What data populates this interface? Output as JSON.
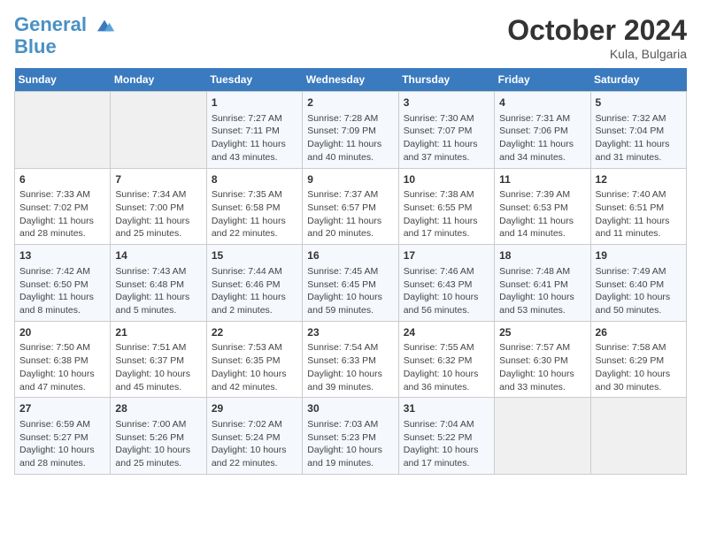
{
  "header": {
    "logo_line1": "General",
    "logo_line2": "Blue",
    "month": "October 2024",
    "location": "Kula, Bulgaria"
  },
  "days_of_week": [
    "Sunday",
    "Monday",
    "Tuesday",
    "Wednesday",
    "Thursday",
    "Friday",
    "Saturday"
  ],
  "weeks": [
    [
      {
        "day": "",
        "info": ""
      },
      {
        "day": "",
        "info": ""
      },
      {
        "day": "1",
        "info": "Sunrise: 7:27 AM\nSunset: 7:11 PM\nDaylight: 11 hours and 43 minutes."
      },
      {
        "day": "2",
        "info": "Sunrise: 7:28 AM\nSunset: 7:09 PM\nDaylight: 11 hours and 40 minutes."
      },
      {
        "day": "3",
        "info": "Sunrise: 7:30 AM\nSunset: 7:07 PM\nDaylight: 11 hours and 37 minutes."
      },
      {
        "day": "4",
        "info": "Sunrise: 7:31 AM\nSunset: 7:06 PM\nDaylight: 11 hours and 34 minutes."
      },
      {
        "day": "5",
        "info": "Sunrise: 7:32 AM\nSunset: 7:04 PM\nDaylight: 11 hours and 31 minutes."
      }
    ],
    [
      {
        "day": "6",
        "info": "Sunrise: 7:33 AM\nSunset: 7:02 PM\nDaylight: 11 hours and 28 minutes."
      },
      {
        "day": "7",
        "info": "Sunrise: 7:34 AM\nSunset: 7:00 PM\nDaylight: 11 hours and 25 minutes."
      },
      {
        "day": "8",
        "info": "Sunrise: 7:35 AM\nSunset: 6:58 PM\nDaylight: 11 hours and 22 minutes."
      },
      {
        "day": "9",
        "info": "Sunrise: 7:37 AM\nSunset: 6:57 PM\nDaylight: 11 hours and 20 minutes."
      },
      {
        "day": "10",
        "info": "Sunrise: 7:38 AM\nSunset: 6:55 PM\nDaylight: 11 hours and 17 minutes."
      },
      {
        "day": "11",
        "info": "Sunrise: 7:39 AM\nSunset: 6:53 PM\nDaylight: 11 hours and 14 minutes."
      },
      {
        "day": "12",
        "info": "Sunrise: 7:40 AM\nSunset: 6:51 PM\nDaylight: 11 hours and 11 minutes."
      }
    ],
    [
      {
        "day": "13",
        "info": "Sunrise: 7:42 AM\nSunset: 6:50 PM\nDaylight: 11 hours and 8 minutes."
      },
      {
        "day": "14",
        "info": "Sunrise: 7:43 AM\nSunset: 6:48 PM\nDaylight: 11 hours and 5 minutes."
      },
      {
        "day": "15",
        "info": "Sunrise: 7:44 AM\nSunset: 6:46 PM\nDaylight: 11 hours and 2 minutes."
      },
      {
        "day": "16",
        "info": "Sunrise: 7:45 AM\nSunset: 6:45 PM\nDaylight: 10 hours and 59 minutes."
      },
      {
        "day": "17",
        "info": "Sunrise: 7:46 AM\nSunset: 6:43 PM\nDaylight: 10 hours and 56 minutes."
      },
      {
        "day": "18",
        "info": "Sunrise: 7:48 AM\nSunset: 6:41 PM\nDaylight: 10 hours and 53 minutes."
      },
      {
        "day": "19",
        "info": "Sunrise: 7:49 AM\nSunset: 6:40 PM\nDaylight: 10 hours and 50 minutes."
      }
    ],
    [
      {
        "day": "20",
        "info": "Sunrise: 7:50 AM\nSunset: 6:38 PM\nDaylight: 10 hours and 47 minutes."
      },
      {
        "day": "21",
        "info": "Sunrise: 7:51 AM\nSunset: 6:37 PM\nDaylight: 10 hours and 45 minutes."
      },
      {
        "day": "22",
        "info": "Sunrise: 7:53 AM\nSunset: 6:35 PM\nDaylight: 10 hours and 42 minutes."
      },
      {
        "day": "23",
        "info": "Sunrise: 7:54 AM\nSunset: 6:33 PM\nDaylight: 10 hours and 39 minutes."
      },
      {
        "day": "24",
        "info": "Sunrise: 7:55 AM\nSunset: 6:32 PM\nDaylight: 10 hours and 36 minutes."
      },
      {
        "day": "25",
        "info": "Sunrise: 7:57 AM\nSunset: 6:30 PM\nDaylight: 10 hours and 33 minutes."
      },
      {
        "day": "26",
        "info": "Sunrise: 7:58 AM\nSunset: 6:29 PM\nDaylight: 10 hours and 30 minutes."
      }
    ],
    [
      {
        "day": "27",
        "info": "Sunrise: 6:59 AM\nSunset: 5:27 PM\nDaylight: 10 hours and 28 minutes."
      },
      {
        "day": "28",
        "info": "Sunrise: 7:00 AM\nSunset: 5:26 PM\nDaylight: 10 hours and 25 minutes."
      },
      {
        "day": "29",
        "info": "Sunrise: 7:02 AM\nSunset: 5:24 PM\nDaylight: 10 hours and 22 minutes."
      },
      {
        "day": "30",
        "info": "Sunrise: 7:03 AM\nSunset: 5:23 PM\nDaylight: 10 hours and 19 minutes."
      },
      {
        "day": "31",
        "info": "Sunrise: 7:04 AM\nSunset: 5:22 PM\nDaylight: 10 hours and 17 minutes."
      },
      {
        "day": "",
        "info": ""
      },
      {
        "day": "",
        "info": ""
      }
    ]
  ]
}
